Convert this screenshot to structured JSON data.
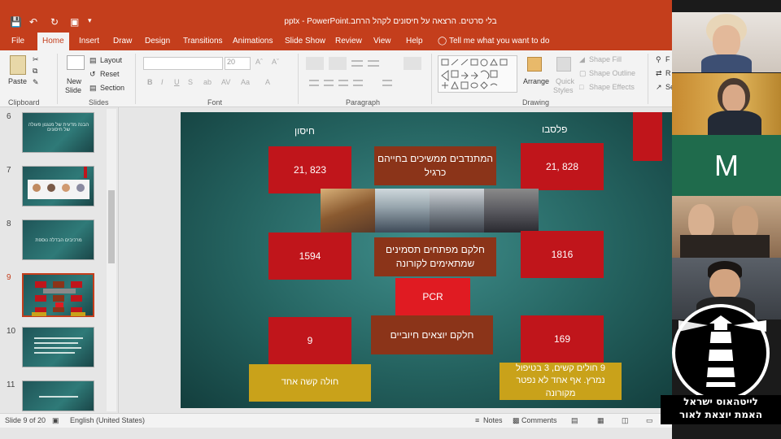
{
  "window": {
    "title": "בלי סרטים. הרצאה על חיסונים לקהל הרחב.pptx - PowerPoint"
  },
  "tabs": [
    "File",
    "Home",
    "Insert",
    "Draw",
    "Design",
    "Transitions",
    "Animations",
    "Slide Show",
    "Review",
    "View",
    "Help"
  ],
  "active_tab": "Home",
  "tell_me": "Tell me what you want to do",
  "ribbon": {
    "clipboard": {
      "paste": "Paste",
      "label": "Clipboard"
    },
    "slides": {
      "new_slide_1": "New",
      "new_slide_2": "Slide",
      "layout": "Layout",
      "reset": "Reset",
      "section": "Section",
      "label": "Slides"
    },
    "font": {
      "size": "20",
      "label": "Font",
      "bold": "B",
      "italic": "I",
      "underline": "U",
      "strike": "S"
    },
    "paragraph": {
      "label": "Paragraph"
    },
    "drawing": {
      "arrange": "Arrange",
      "quick_styles_1": "Quick",
      "quick_styles_2": "Styles",
      "shape_fill": "Shape Fill",
      "shape_outline": "Shape Outline",
      "shape_effects": "Shape Effects",
      "label": "Drawing"
    },
    "editing": {
      "find": "F",
      "replace": "R",
      "select": "Se"
    }
  },
  "thumbnails": [
    {
      "num": "6",
      "text": "הבנה מדעית של מנגנון פעולה של חיסונים"
    },
    {
      "num": "7",
      "text": ""
    },
    {
      "num": "8",
      "text": "מרכיבים הבדלה נוספת"
    },
    {
      "num": "9",
      "text": ""
    },
    {
      "num": "10",
      "text": ""
    },
    {
      "num": "11",
      "text": ""
    }
  ],
  "slide": {
    "left_header": "פלסבו",
    "right_header": "חיסון",
    "placebo_total": "21, 828",
    "vaccine_total": "21, 823",
    "center_top": "המתנדבים ממשיכים בחייהם כרגיל",
    "placebo_symptoms": "1816",
    "vaccine_symptoms": "1594",
    "center_mid": "חלקם מפתחים תסמינים שמתאימים לקורונה",
    "pcr": "PCR",
    "placebo_positive": "169",
    "vaccine_positive": "9",
    "center_bottom": "חלקם יוצאים חיוביים",
    "placebo_note": "9 חולים קשים, 3 בטיפול נמרץ. אף אחד לא נפטר מקורונה",
    "vaccine_note": "חולה קשה אחד"
  },
  "status": {
    "slide_info": "Slide 9 of 20",
    "language": "English (United States)",
    "notes": "Notes",
    "comments": "Comments"
  },
  "participants": [
    {
      "initial": "M",
      "color": "#1f6b4c"
    }
  ],
  "logo": {
    "line1": "לייטהאוס ישראל",
    "line2": "האמת יוצאת לאור"
  }
}
